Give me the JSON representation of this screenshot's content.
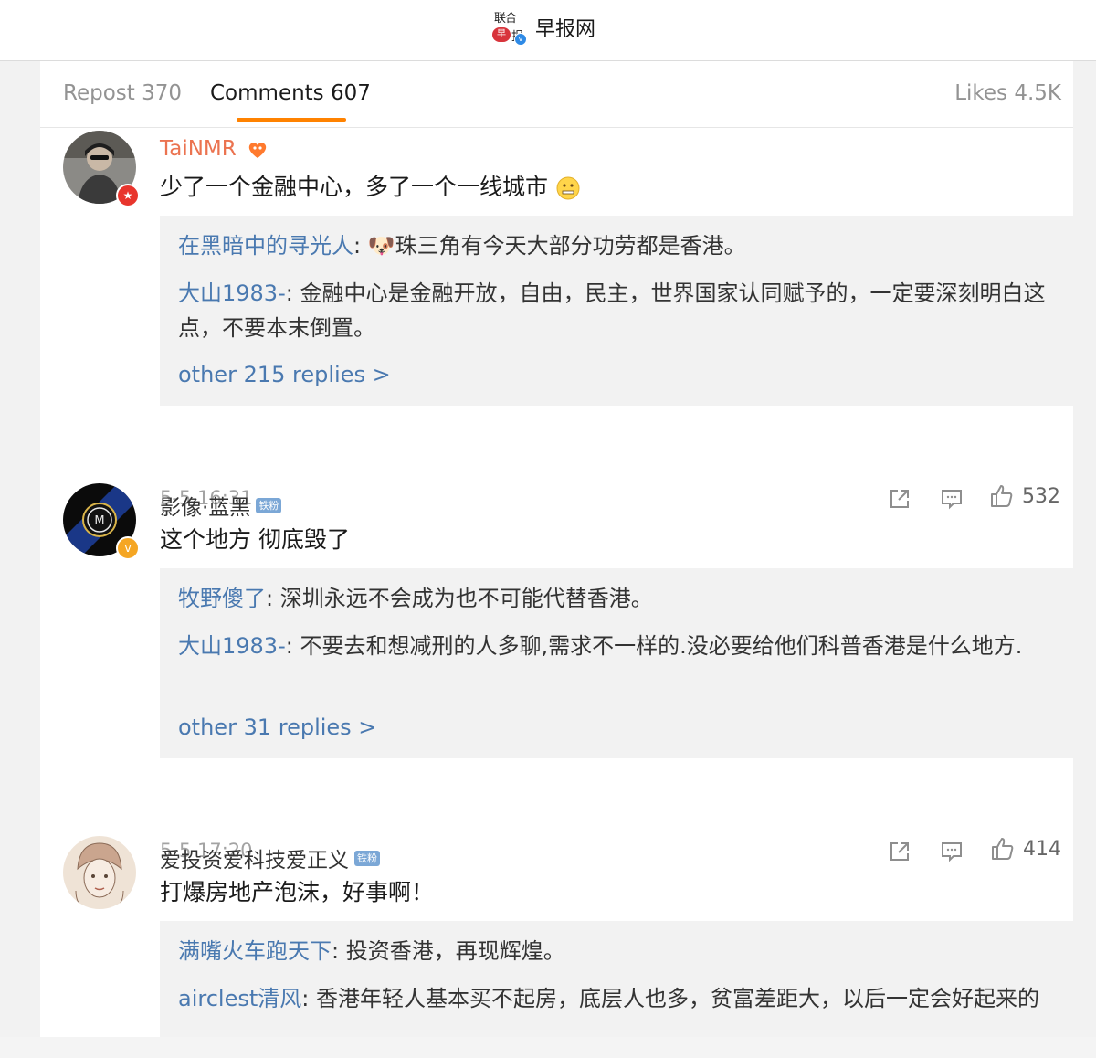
{
  "header": {
    "logo_text_top": "联合",
    "logo_text_bottom_left": "早",
    "logo_text_bottom_right": "报",
    "brand_name": "早报网",
    "accent_color": "#ff8200"
  },
  "tabs": {
    "repost": "Repost 370",
    "comments": "Comments 607",
    "likes": "Likes 4.5K"
  },
  "comments": [
    {
      "username": "TaiNMR",
      "text": "少了一个金融中心，多了一个一线城市",
      "replies": [
        {
          "name": "在黑暗中的寻光人",
          "text": ": 🐶珠三角有今天大部分功劳都是香港。"
        },
        {
          "name": "大山1983-",
          "text": ": 金融中心是金融开放，自由，民主，世界国家认同赋予的，一定要深刻明白这点，不要本末倒置。"
        }
      ],
      "more": "other 215 replies >",
      "time": "5-5 16:31",
      "likes": "532"
    },
    {
      "username": "影像·蓝黑",
      "tag": "铁粉",
      "text": "这个地方 彻底毁了",
      "replies": [
        {
          "name": "牧野傻了",
          "text": ": 深圳永远不会成为也不可能代替香港。"
        },
        {
          "name": "大山1983-",
          "text": ": 不要去和想减刑的人多聊,需求不一样的.没必要给他们科普香港是什么地方."
        }
      ],
      "more": "other 31 replies >",
      "time": "5-5 17:20",
      "likes": "414"
    },
    {
      "username": "爱投资爱科技爱正义",
      "tag": "铁粉",
      "text": "打爆房地产泡沫，好事啊！",
      "replies": [
        {
          "name": "满嘴火车跑天下",
          "text": ": 投资香港，再现辉煌。"
        },
        {
          "name": "airclest清风",
          "text": ": 香港年轻人基本买不起房，底层人也多，贫富差距大，以后一定会好起来的"
        }
      ]
    }
  ]
}
